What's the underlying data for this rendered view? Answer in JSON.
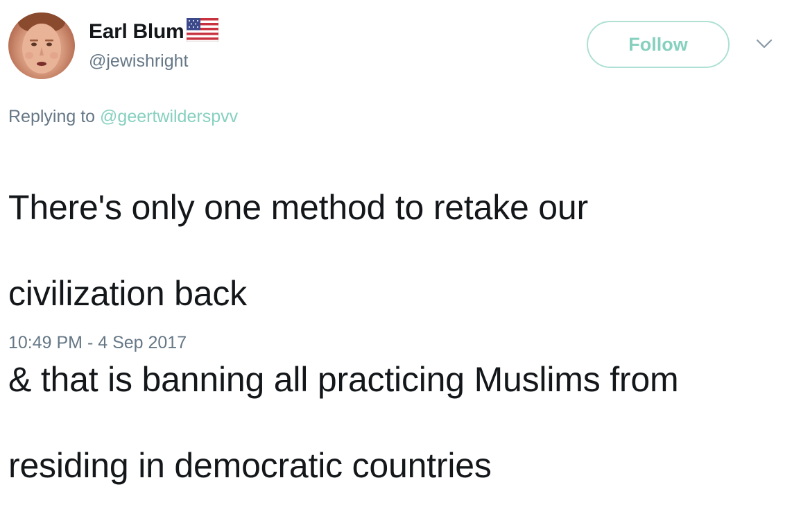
{
  "author": {
    "display_name": "Earl Blum",
    "handle": "@jewishright",
    "flag_icon": "us-flag-icon",
    "avatar_icon": "profile-photo"
  },
  "actions": {
    "follow_label": "Follow",
    "menu_icon": "chevron-down-icon"
  },
  "reply": {
    "prefix": "Replying to",
    "mention": "@geertwilderspvv"
  },
  "tweet": {
    "text_line_1": "There's only one method to retake our",
    "text_line_2": "civilization back",
    "text_line_3": "& that is banning all practicing Muslims from",
    "text_line_4": "residing in democratic countries",
    "timestamp": "10:49 PM - 4 Sep 2017"
  },
  "colors": {
    "text_primary": "#14171a",
    "text_secondary": "#657786",
    "accent": "#86d0bf",
    "follow_border": "#aee0d4"
  }
}
